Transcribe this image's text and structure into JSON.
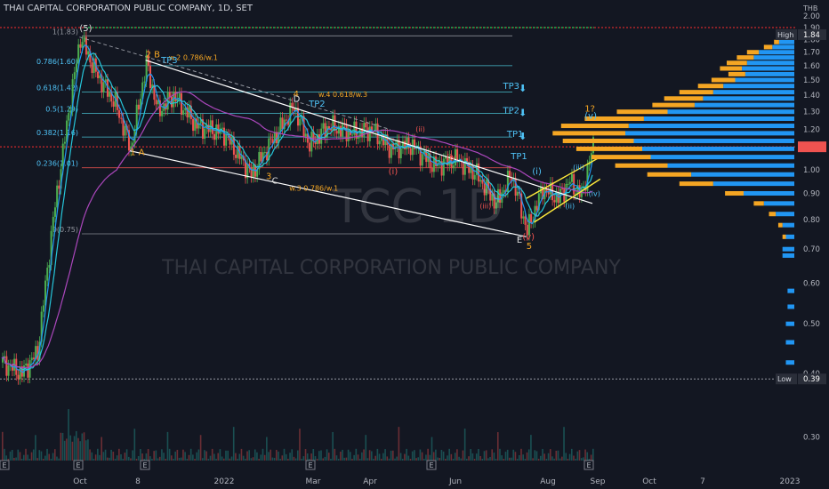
{
  "header": {
    "title": "THAI CAPITAL CORPORATION PUBLIC COMPANY, 1D, SET"
  },
  "watermark": {
    "ticker": "TCC",
    "interval": "1D",
    "name": "THAI CAPITAL CORPORATION PUBLIC COMPANY"
  },
  "colors": {
    "background": "#131722",
    "up": "#26a69a",
    "down": "#ef5350",
    "green_candle": "#4caf50",
    "ma_fast": "#2196f3",
    "ma_mid": "#26c6da",
    "ma_slow": "#ab47bc",
    "fib": "#4dd0e1",
    "wave_orange": "#f5a623",
    "wave_red": "#ef5350",
    "channel": "#ffffff",
    "channel_yellow": "#ffeb3b",
    "vp_blue": "#2196f3",
    "vp_orange": "#f5a623",
    "resistance_red": "#ff2d2d",
    "resistance_green": "#26ff6b"
  },
  "chart_data": {
    "type": "candlestick",
    "title": "THAI CAPITAL CORPORATION PUBLIC COMPANY, 1D, SET",
    "currency": "THB",
    "y_scale": "log",
    "ylim": [
      0.27,
      2.05
    ],
    "y_ticks": [
      2.0,
      1.9,
      1.8,
      1.7,
      1.6,
      1.5,
      1.4,
      1.3,
      1.2,
      1.1,
      1.0,
      0.9,
      0.8,
      0.7,
      0.6,
      0.5,
      0.4,
      0.3
    ],
    "x_ticks": [
      "Oct",
      "8",
      "2022",
      "Mar",
      "Apr",
      "Jun",
      "Aug",
      "Sep",
      "Oct",
      "7",
      "2023"
    ],
    "price_labels": [
      {
        "label": "High",
        "value": "1.84",
        "price": 1.84
      },
      {
        "label": "Low",
        "value": "0.39",
        "price": 0.39
      }
    ],
    "key_points": [
      {
        "day": 0,
        "price": 0.42
      },
      {
        "day": 10,
        "price": 0.4
      },
      {
        "day": 18,
        "price": 0.44
      },
      {
        "day": 26,
        "price": 0.8
      },
      {
        "day": 34,
        "price": 1.3
      },
      {
        "day": 40,
        "price": 1.82
      },
      {
        "day": 48,
        "price": 1.55
      },
      {
        "day": 58,
        "price": 1.35
      },
      {
        "day": 66,
        "price": 1.1
      },
      {
        "day": 74,
        "price": 1.62
      },
      {
        "day": 80,
        "price": 1.3
      },
      {
        "day": 88,
        "price": 1.4
      },
      {
        "day": 100,
        "price": 1.22
      },
      {
        "day": 114,
        "price": 1.18
      },
      {
        "day": 128,
        "price": 0.98
      },
      {
        "day": 136,
        "price": 1.1
      },
      {
        "day": 150,
        "price": 1.33
      },
      {
        "day": 158,
        "price": 1.12
      },
      {
        "day": 168,
        "price": 1.22
      },
      {
        "day": 180,
        "price": 1.18
      },
      {
        "day": 190,
        "price": 1.2
      },
      {
        "day": 200,
        "price": 1.1
      },
      {
        "day": 210,
        "price": 1.12
      },
      {
        "day": 222,
        "price": 1.02
      },
      {
        "day": 234,
        "price": 1.05
      },
      {
        "day": 244,
        "price": 0.98
      },
      {
        "day": 254,
        "price": 0.86
      },
      {
        "day": 262,
        "price": 0.98
      },
      {
        "day": 270,
        "price": 0.76
      },
      {
        "day": 278,
        "price": 0.92
      },
      {
        "day": 286,
        "price": 0.88
      },
      {
        "day": 292,
        "price": 0.95
      },
      {
        "day": 298,
        "price": 0.89
      },
      {
        "day": 304,
        "price": 1.12
      }
    ],
    "fib_levels": [
      {
        "label": "1(1.83)",
        "price": 1.83
      },
      {
        "label": "0.786(1.60)",
        "price": 1.6
      },
      {
        "label": "0.618(1.42)",
        "price": 1.42
      },
      {
        "label": "0.5(1.29)",
        "price": 1.29
      },
      {
        "label": "0.382(1.16)",
        "price": 1.16
      },
      {
        "label": "0.236(1.01)",
        "price": 1.01
      },
      {
        "label": "0(0.75)",
        "price": 0.75
      }
    ],
    "hlines": [
      {
        "name": "red-resistance",
        "price": 1.9,
        "style": "dotted"
      },
      {
        "name": "red-current",
        "price": 1.11,
        "style": "dotted"
      },
      {
        "name": "low-line",
        "price": 0.39,
        "style": "dotted"
      }
    ],
    "wave_labels": [
      {
        "text": "(5)",
        "day": 40,
        "price": 1.87
      },
      {
        "text": "2 B",
        "day": 74,
        "price": 1.66
      },
      {
        "text": "w.2 0.786/w.1",
        "day": 86,
        "price": 1.64
      },
      {
        "text": "TP3",
        "day": 82,
        "price": 1.62
      },
      {
        "text": "4",
        "day": 150,
        "price": 1.39
      },
      {
        "text": "D",
        "day": 150,
        "price": 1.36
      },
      {
        "text": "w.4 0.618/w.3",
        "day": 163,
        "price": 1.39
      },
      {
        "text": "TP2",
        "day": 158,
        "price": 1.33
      },
      {
        "text": "1 A",
        "day": 66,
        "price": 1.07
      },
      {
        "text": "3",
        "day": 136,
        "price": 0.96
      },
      {
        "text": "C",
        "day": 139,
        "price": 0.94
      },
      {
        "text": "w.3 0.786/w.1",
        "day": 148,
        "price": 0.91
      },
      {
        "text": "(i)",
        "day": 199,
        "price": 0.98
      },
      {
        "text": "(ii)",
        "day": 213,
        "price": 1.19
      },
      {
        "text": "(iii)",
        "day": 246,
        "price": 0.84
      },
      {
        "text": "(iv)",
        "day": 229,
        "price": 1.05
      },
      {
        "text": "(v)",
        "day": 268,
        "price": 0.73
      },
      {
        "text": "E",
        "day": 265,
        "price": 0.72
      },
      {
        "text": "5",
        "day": 270,
        "price": 0.7
      },
      {
        "text": "(i)",
        "day": 273,
        "price": 0.98
      },
      {
        "text": "(ii)",
        "day": 290,
        "price": 0.84
      },
      {
        "text": "(iii)",
        "day": 294,
        "price": 1.0
      },
      {
        "text": "(iv)",
        "day": 302,
        "price": 0.89
      },
      {
        "text": "1?",
        "day": 300,
        "price": 1.3
      },
      {
        "text": "(v)",
        "day": 300,
        "price": 1.26
      },
      {
        "text": "TP3",
        "day": 258,
        "price": 1.44
      },
      {
        "text": "TP2",
        "day": 258,
        "price": 1.29
      },
      {
        "text": "TP1",
        "day": 260,
        "price": 1.16
      },
      {
        "text": "TP1",
        "day": 262,
        "price": 1.05
      }
    ],
    "volume_profile": {
      "bins": [
        {
          "price": 1.82,
          "blue": 10,
          "orange": 4
        },
        {
          "price": 1.78,
          "blue": 18,
          "orange": 6
        },
        {
          "price": 1.74,
          "blue": 26,
          "orange": 10
        },
        {
          "price": 1.7,
          "blue": 42,
          "orange": 14
        },
        {
          "price": 1.66,
          "blue": 48,
          "orange": 20
        },
        {
          "price": 1.62,
          "blue": 56,
          "orange": 24
        },
        {
          "price": 1.58,
          "blue": 62,
          "orange": 26
        },
        {
          "price": 1.54,
          "blue": 58,
          "orange": 20
        },
        {
          "price": 1.5,
          "blue": 70,
          "orange": 28
        },
        {
          "price": 1.46,
          "blue": 84,
          "orange": 30
        },
        {
          "price": 1.42,
          "blue": 96,
          "orange": 40
        },
        {
          "price": 1.38,
          "blue": 108,
          "orange": 46
        },
        {
          "price": 1.34,
          "blue": 118,
          "orange": 50
        },
        {
          "price": 1.3,
          "blue": 150,
          "orange": 60
        },
        {
          "price": 1.26,
          "blue": 178,
          "orange": 70
        },
        {
          "price": 1.22,
          "blue": 196,
          "orange": 80
        },
        {
          "price": 1.18,
          "blue": 200,
          "orange": 86
        },
        {
          "price": 1.14,
          "blue": 190,
          "orange": 84
        },
        {
          "price": 1.1,
          "blue": 180,
          "orange": 78
        },
        {
          "price": 1.06,
          "blue": 170,
          "orange": 70
        },
        {
          "price": 1.02,
          "blue": 150,
          "orange": 62
        },
        {
          "price": 0.98,
          "blue": 122,
          "orange": 52
        },
        {
          "price": 0.94,
          "blue": 96,
          "orange": 40
        },
        {
          "price": 0.9,
          "blue": 60,
          "orange": 22
        },
        {
          "price": 0.86,
          "blue": 36,
          "orange": 12
        },
        {
          "price": 0.82,
          "blue": 22,
          "orange": 8
        },
        {
          "price": 0.78,
          "blue": 14,
          "orange": 5
        },
        {
          "price": 0.74,
          "blue": 10,
          "orange": 4
        },
        {
          "price": 0.7,
          "blue": 14,
          "orange": 0
        },
        {
          "price": 0.68,
          "blue": 14,
          "orange": 0
        },
        {
          "price": 0.58,
          "blue": 8,
          "orange": 0
        },
        {
          "price": 0.54,
          "blue": 8,
          "orange": 0
        },
        {
          "price": 0.5,
          "blue": 10,
          "orange": 0
        },
        {
          "price": 0.46,
          "blue": 10,
          "orange": 0
        },
        {
          "price": 0.42,
          "blue": 10,
          "orange": 0
        }
      ]
    },
    "earnings_markers": [
      "E",
      "E",
      "E",
      "E",
      "E",
      "E"
    ]
  }
}
